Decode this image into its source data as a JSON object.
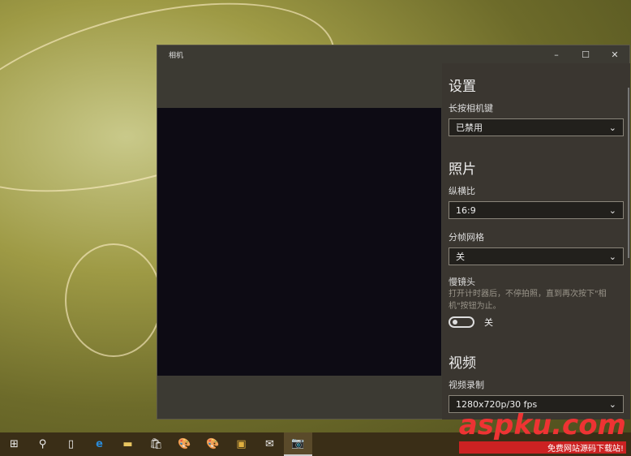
{
  "window": {
    "title": "相机",
    "minimize": "–",
    "maximize": "☐",
    "close": "✕"
  },
  "settings": {
    "title": "设置",
    "camera_button_label": "长按相机键",
    "camera_button_value": "已禁用",
    "photo_title": "照片",
    "aspect_label": "纵横比",
    "aspect_value": "16:9",
    "grid_label": "分帧网格",
    "grid_value": "关",
    "timelapse_label": "慢镜头",
    "timelapse_desc": "打开计时器后，不停拍照，直到再次按下\"相机\"按钮为止。",
    "timelapse_state": "关",
    "video_title": "视频",
    "video_label": "视频录制",
    "video_value": "1280x720p/30 fps",
    "chevron": "⌄"
  },
  "taskbar": {
    "items": [
      "⊞",
      "⚲",
      "▯",
      "e",
      "▬",
      "🛍",
      "🎨",
      "🎨",
      "▣",
      "✉",
      "📷"
    ]
  },
  "watermark": {
    "brand": "aspku.com",
    "tagline": "免费网站源码下载站!"
  }
}
